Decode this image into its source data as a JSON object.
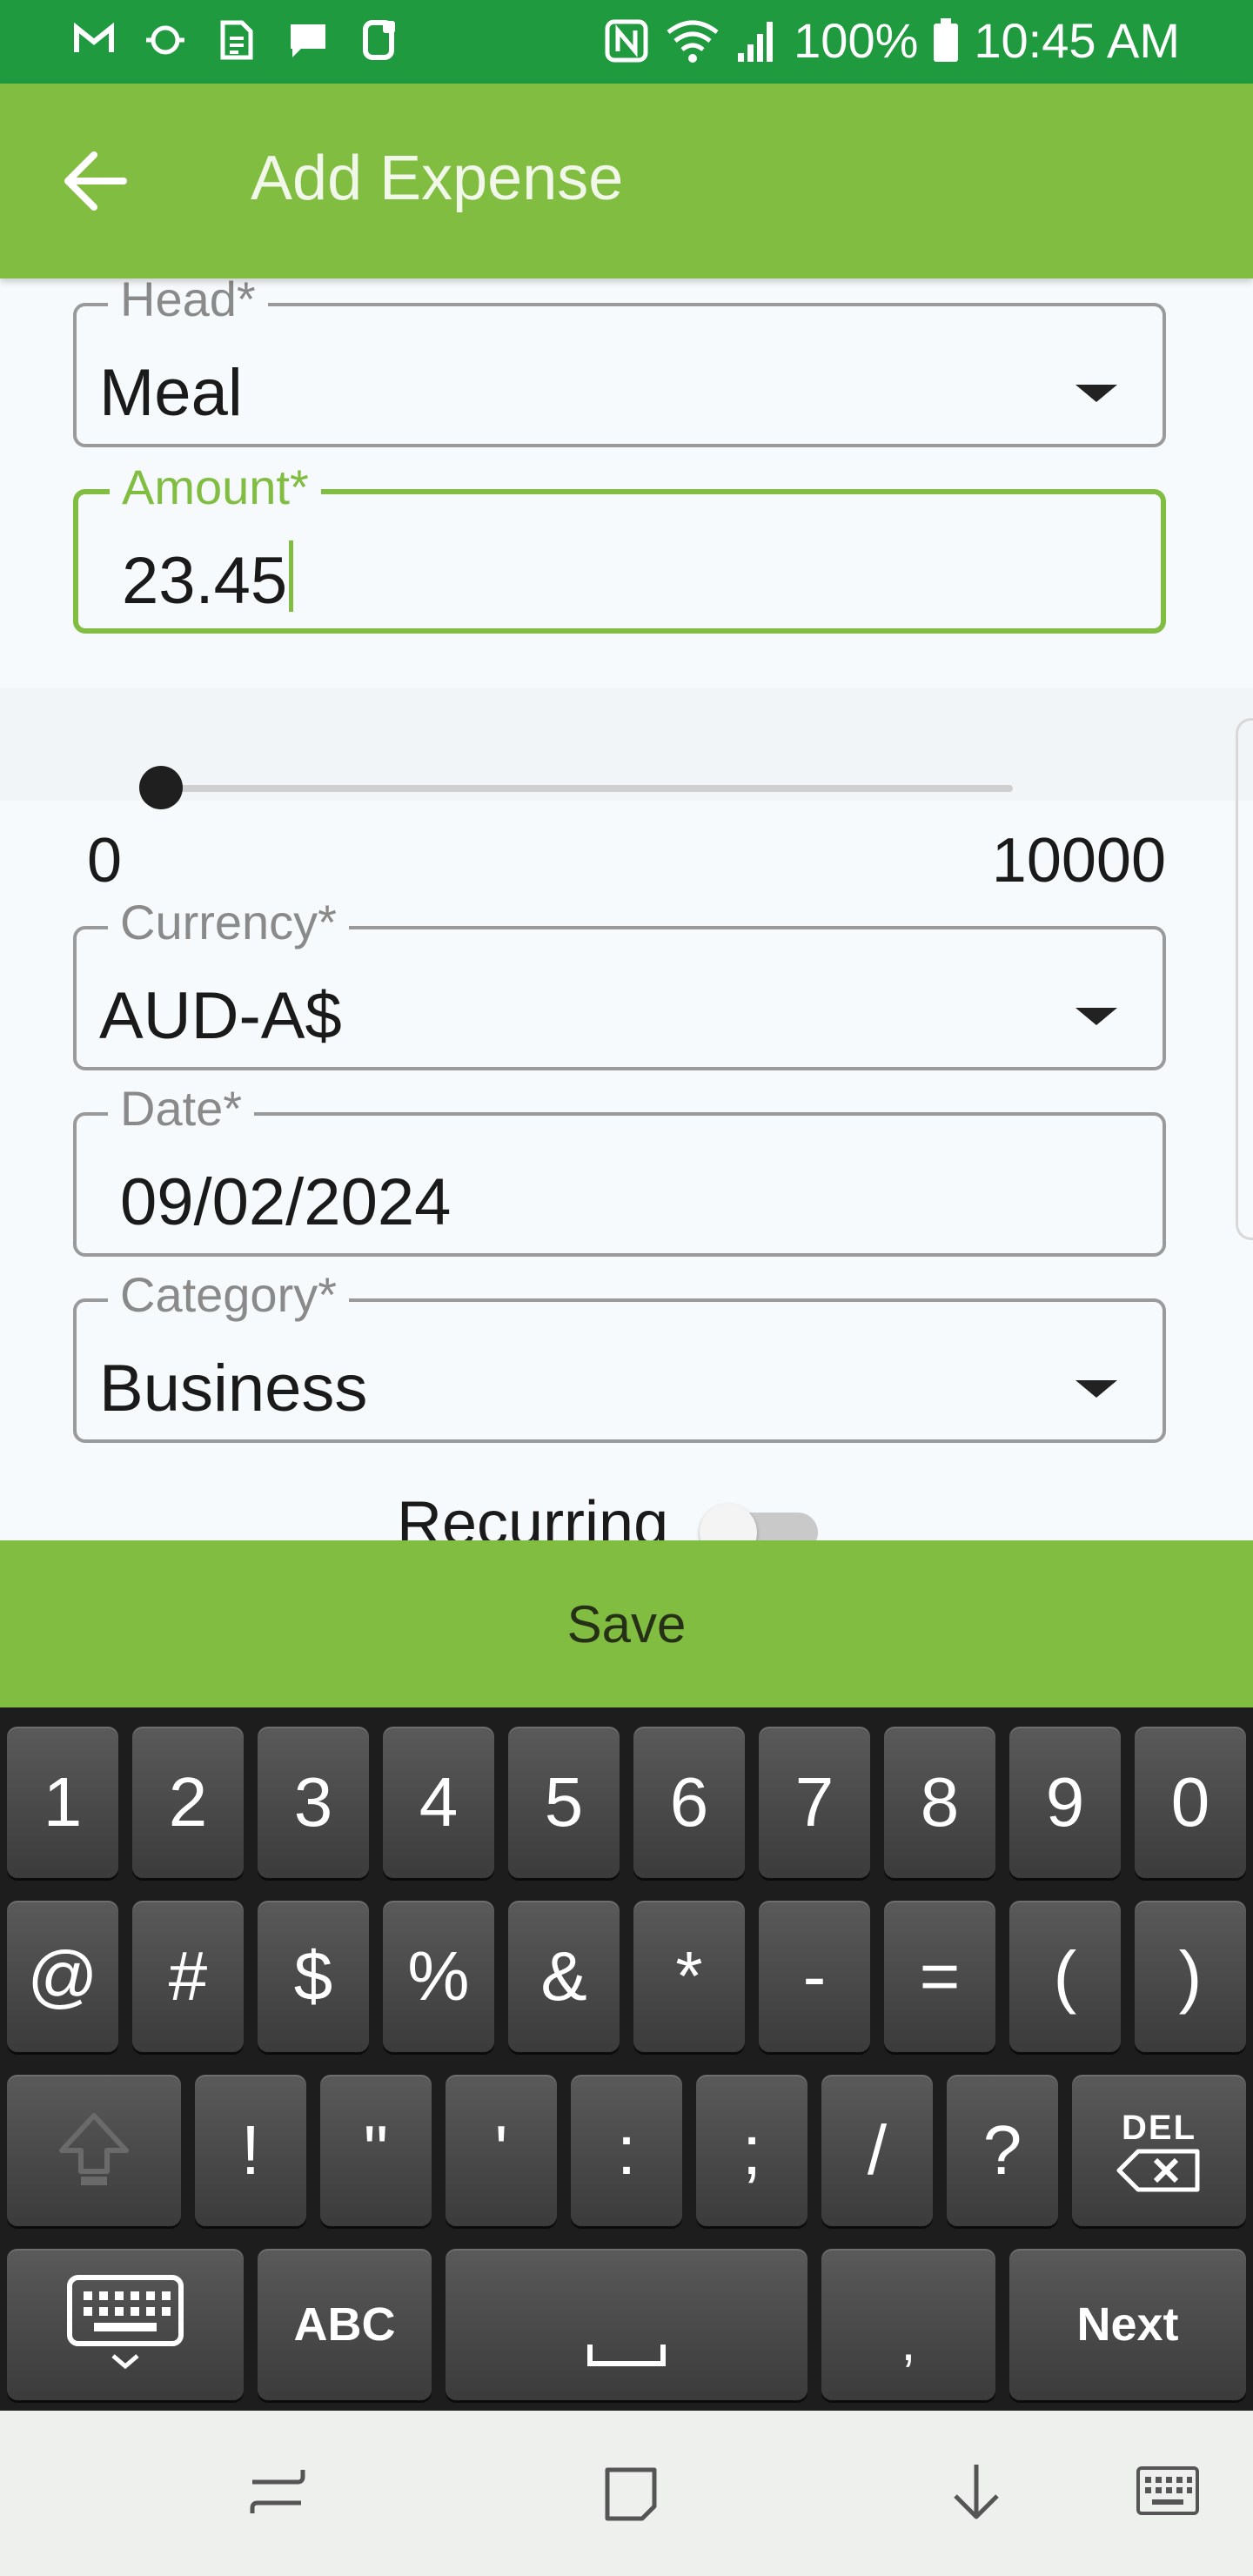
{
  "status_bar": {
    "battery": "100%",
    "time": "10:45 AM",
    "left_icons": [
      "gmail-icon",
      "sync-icon",
      "sim-icon",
      "message-icon",
      "voicemail-icon"
    ],
    "right_icons": [
      "nfc-icon",
      "wifi-icon",
      "signal-icon",
      "battery-icon"
    ]
  },
  "app_bar": {
    "title": "Add Expense",
    "back_icon": "arrow-left-icon"
  },
  "form": {
    "head": {
      "label": "Head*",
      "value": "Meal"
    },
    "amount": {
      "label": "Amount*",
      "value": "23.45"
    },
    "slider": {
      "min": "0",
      "max": "10000",
      "value": 0
    },
    "currency": {
      "label": "Currency*",
      "value": "AUD-A$"
    },
    "date": {
      "label": "Date*",
      "value": "09/02/2024"
    },
    "category": {
      "label": "Category*",
      "value": "Business"
    },
    "recurring": {
      "label": "Recurring",
      "on": false
    }
  },
  "save_label": "Save",
  "keyboard": {
    "row1": [
      "1",
      "2",
      "3",
      "4",
      "5",
      "6",
      "7",
      "8",
      "9",
      "0"
    ],
    "row2": [
      "@",
      "#",
      "$",
      "%",
      "&",
      "*",
      "-",
      "=",
      "(",
      ")"
    ],
    "row3": [
      "!",
      "\"",
      "'",
      ":",
      ";",
      "/",
      "?"
    ],
    "del_label": "DEL",
    "abc_label": "ABC",
    "comma": ",",
    "next_label": "Next"
  },
  "nav_bar": {
    "icons": [
      "recent-apps-icon",
      "home-icon",
      "back-icon",
      "keyboard-switch-icon"
    ]
  },
  "colors": {
    "status_bar": "#1f9a3f",
    "accent": "#80bd41",
    "keyboard_bg": "#1d1d1d"
  }
}
